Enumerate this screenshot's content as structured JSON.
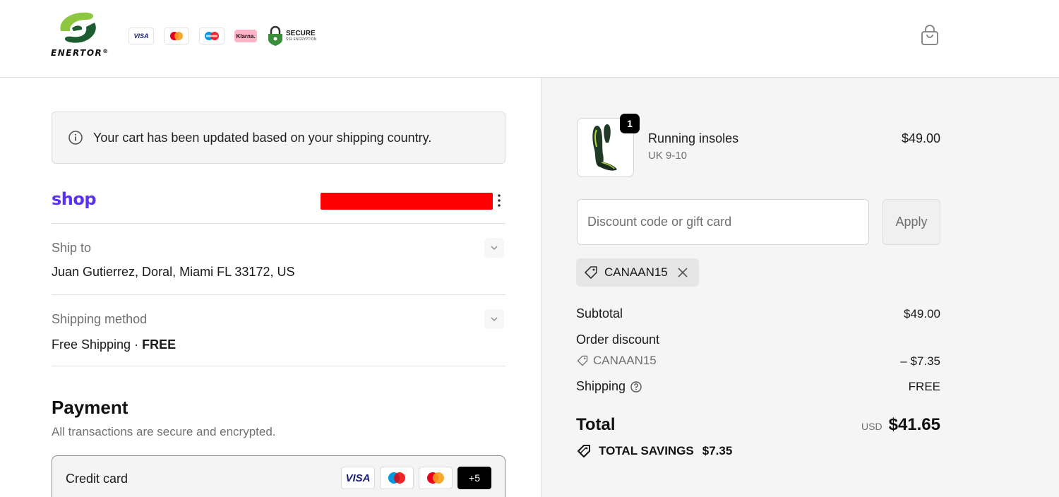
{
  "header": {
    "brand": "ENERTOR",
    "brand_mark": "®",
    "badges": [
      "VISA",
      "Klarna."
    ],
    "secure": {
      "title": "SECURE",
      "subtitle": "SSL ENCRYPTION"
    }
  },
  "notice": {
    "text": "Your cart has been updated based on your shipping country."
  },
  "shop": {
    "label": "shop"
  },
  "ship_to": {
    "label": "Ship to",
    "value": "Juan Gutierrez, Doral, Miami FL 33172, US"
  },
  "shipping_method": {
    "label": "Shipping method",
    "value": "Free Shipping · ",
    "price": "FREE"
  },
  "payment": {
    "title": "Payment",
    "subtitle": "All transactions are secure and encrypted.",
    "method": "Credit card",
    "cards": [
      "VISA",
      "+5"
    ]
  },
  "cart": {
    "item": {
      "quantity": "1",
      "name": "Running insoles",
      "variant": "UK 9-10",
      "price": "$49.00"
    },
    "discount_placeholder": "Discount code or gift card",
    "apply_label": "Apply",
    "applied_code": "CANAAN15",
    "subtotal_label": "Subtotal",
    "subtotal_value": "$49.00",
    "order_discount_label": "Order discount",
    "discount_code": "CANAAN15",
    "discount_value": "– $7.35",
    "shipping_label": "Shipping",
    "shipping_value": "FREE",
    "total_label": "Total",
    "total_currency": "USD",
    "total_value": "$41.65",
    "savings_label": "TOTAL SAVINGS",
    "savings_value": "$7.35"
  },
  "colors": {
    "shop_purple": "#5a31f4",
    "redaction": "#ff0000",
    "brand_green": "#8dc63f",
    "brand_dark_green": "#1e5b2e"
  },
  "icons": [
    "info-icon",
    "bag-icon",
    "tag-icon",
    "close-icon",
    "question-icon",
    "chevron-down-icon",
    "kebab-icon",
    "lock-icon"
  ]
}
